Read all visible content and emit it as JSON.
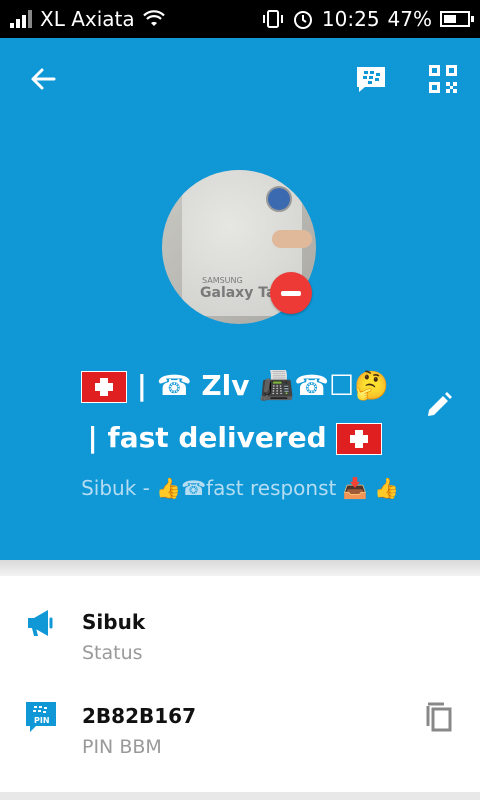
{
  "status_bar": {
    "carrier": "XL Axiata",
    "time": "10:25",
    "battery": "47%"
  },
  "profile": {
    "name_line1": "| ☎ Zlv 📠☎☐🤔",
    "name_line2": "| fast delivered",
    "status_message": "Sibuk - 👍☎fast responst 📥 👍",
    "avatar_brand": "SAMSUNG",
    "avatar_text": "Galaxy Tab"
  },
  "details": [
    {
      "value": "Sibuk",
      "label": "Status",
      "icon": "megaphone-icon"
    },
    {
      "value": "2B82B167",
      "label": "PIN BBM",
      "icon": "bbm-pin-icon"
    }
  ],
  "colors": {
    "header_bg": "#0f97d6",
    "accent": "#0f97d6",
    "remove": "#ee3a36",
    "flag": "#e02020"
  }
}
